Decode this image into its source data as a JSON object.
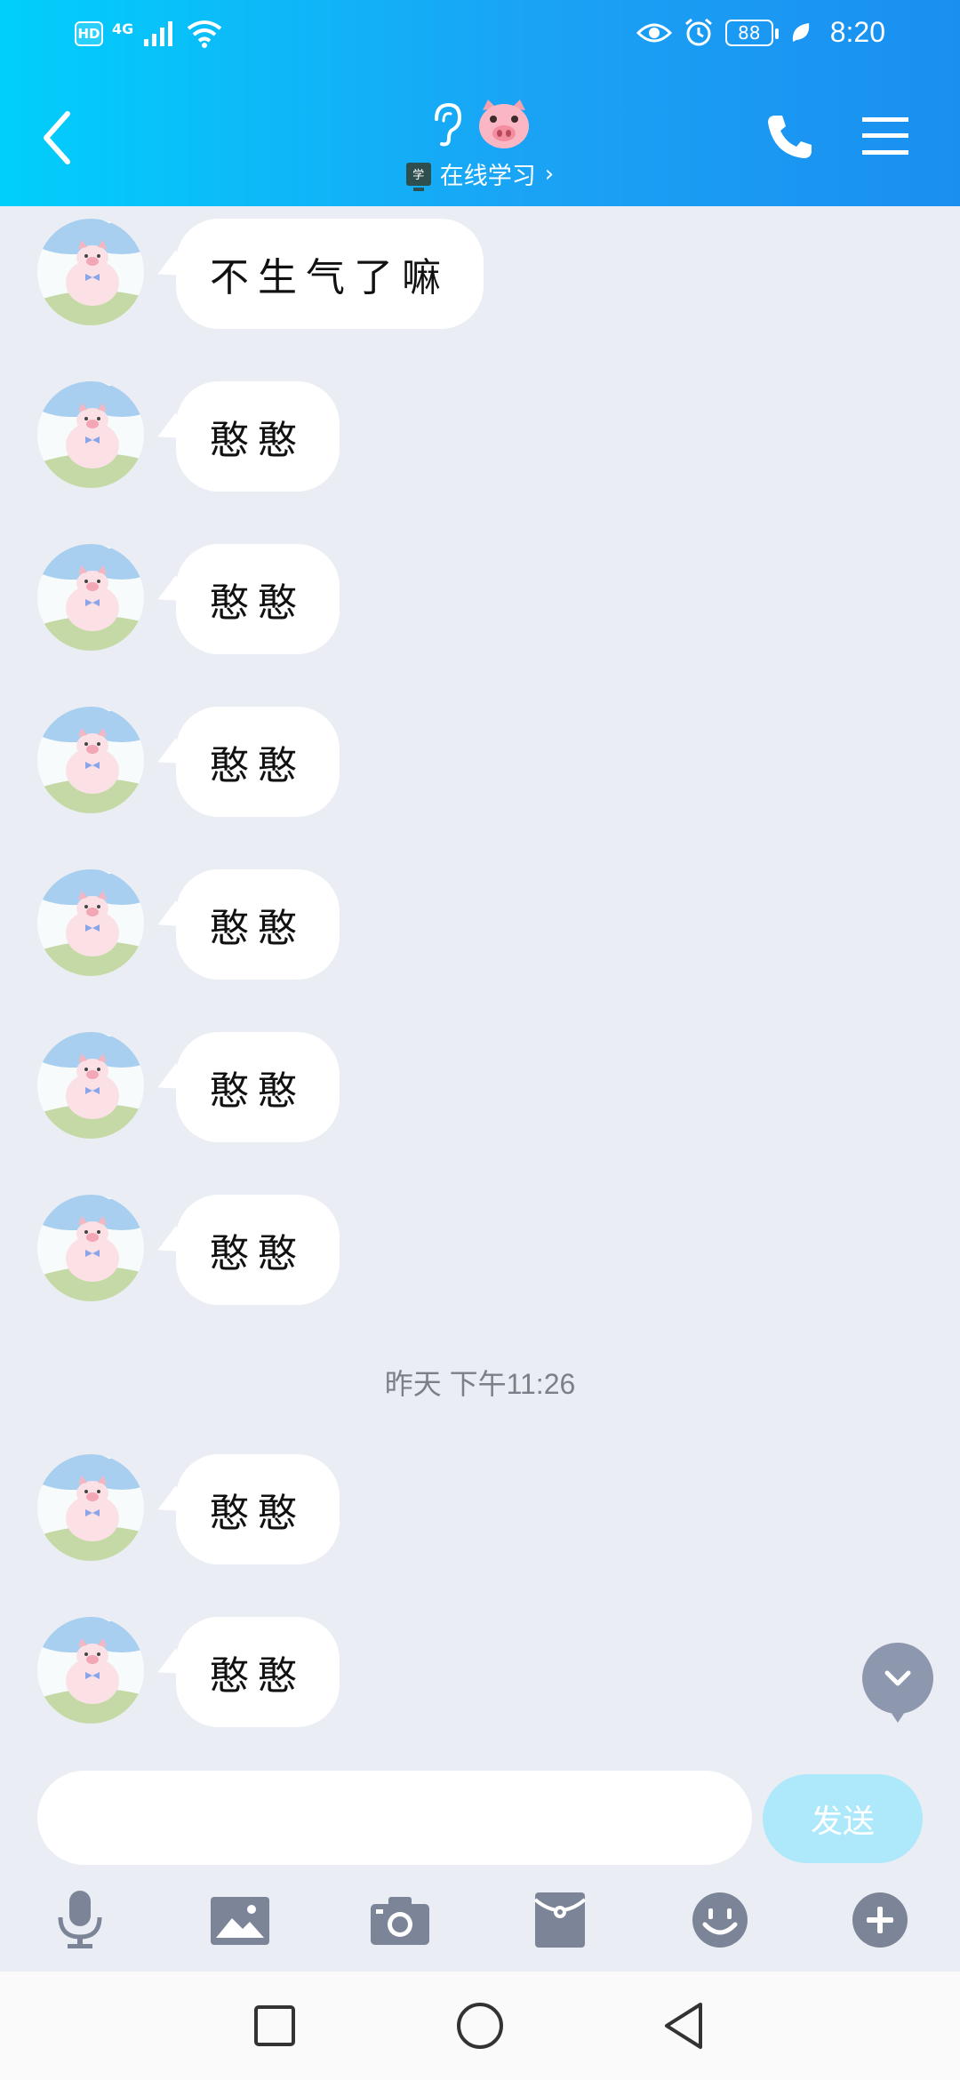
{
  "status_bar": {
    "hd_label": "HD",
    "network_label": "4G",
    "battery_level": "88",
    "time": "8:20"
  },
  "header": {
    "back_icon": "chevron-left-icon",
    "title_icon": "ear-icon",
    "title_emoji": "🐷",
    "status_badge": "学",
    "status_text": "在线学习",
    "status_chevron": "›",
    "call_icon": "phone-icon",
    "menu_icon": "menu-icon"
  },
  "messages_before": [
    {
      "text": "不生气了嘛"
    },
    {
      "text": "憨憨"
    },
    {
      "text": "憨憨"
    },
    {
      "text": "憨憨"
    },
    {
      "text": "憨憨"
    },
    {
      "text": "憨憨"
    },
    {
      "text": "憨憨"
    }
  ],
  "timestamp": "昨天 下午11:26",
  "messages_after": [
    {
      "text": "憨憨"
    },
    {
      "text": "憨憨"
    }
  ],
  "input": {
    "value": "",
    "send_label": "发送"
  },
  "toolbar": [
    {
      "icon": "microphone-icon"
    },
    {
      "icon": "image-icon"
    },
    {
      "icon": "camera-icon"
    },
    {
      "icon": "red-packet-icon"
    },
    {
      "icon": "emoji-icon"
    },
    {
      "icon": "plus-icon"
    }
  ],
  "navbar": [
    {
      "icon": "recent-apps-icon"
    },
    {
      "icon": "home-icon"
    },
    {
      "icon": "back-icon"
    }
  ],
  "colors": {
    "header_start": "#00cffb",
    "header_end": "#1a8ff0",
    "chat_bg": "#eaedf4",
    "send_button": "#aee9fb",
    "tool_icon": "#7c8597"
  }
}
